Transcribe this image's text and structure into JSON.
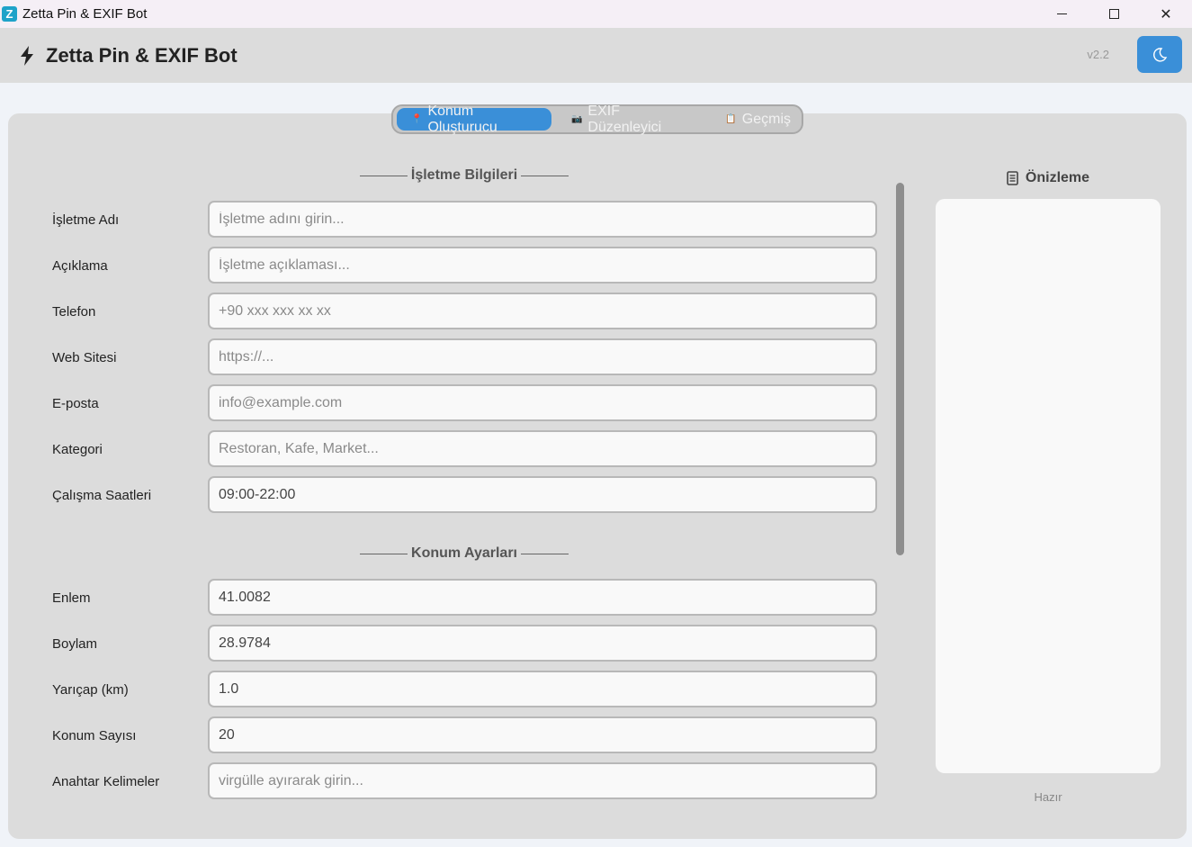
{
  "window": {
    "icon_letter": "Z",
    "title": "Zetta Pin & EXIF Bot",
    "minimize": "",
    "maximize": "",
    "close": "✕"
  },
  "header": {
    "title": "Zetta Pin & EXIF Bot",
    "version": "v2.2",
    "accent_color": "#3a8fd8"
  },
  "tabs": [
    {
      "icon": "📍",
      "label": "Konum Oluşturucu",
      "active": true
    },
    {
      "icon": "📷",
      "label": "EXIF Düzenleyici",
      "active": false
    },
    {
      "icon": "📋",
      "label": "Geçmiş",
      "active": false
    }
  ],
  "sections": {
    "business": "İşletme Bilgileri",
    "location": "Konum Ayarları"
  },
  "business_fields": [
    {
      "label": "İşletme Adı",
      "placeholder": "İşletme adını girin...",
      "value": ""
    },
    {
      "label": "Açıklama",
      "placeholder": "İşletme açıklaması...",
      "value": ""
    },
    {
      "label": "Telefon",
      "placeholder": "+90 xxx xxx xx xx",
      "value": ""
    },
    {
      "label": "Web Sitesi",
      "placeholder": "https://...",
      "value": ""
    },
    {
      "label": "E-posta",
      "placeholder": "info@example.com",
      "value": ""
    },
    {
      "label": "Kategori",
      "placeholder": "Restoran, Kafe, Market...",
      "value": ""
    },
    {
      "label": "Çalışma Saatleri",
      "placeholder": "",
      "value": "09:00-22:00"
    }
  ],
  "location_fields": [
    {
      "label": "Enlem",
      "placeholder": "",
      "value": "41.0082"
    },
    {
      "label": "Boylam",
      "placeholder": "",
      "value": "28.9784"
    },
    {
      "label": "Yarıçap (km)",
      "placeholder": "",
      "value": "1.0"
    },
    {
      "label": "Konum Sayısı",
      "placeholder": "",
      "value": "20"
    },
    {
      "label": "Anahtar Kelimeler",
      "placeholder": "virgülle ayırarak girin...",
      "value": ""
    }
  ],
  "preview": {
    "title": "Önizleme",
    "status": "Hazır"
  }
}
